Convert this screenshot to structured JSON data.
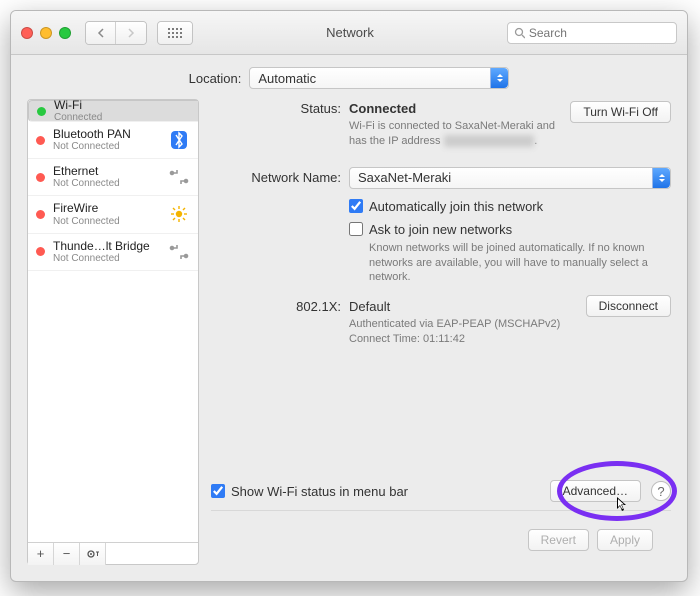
{
  "window": {
    "title": "Network"
  },
  "search": {
    "placeholder": "Search"
  },
  "location": {
    "label": "Location:",
    "value": "Automatic"
  },
  "sidebar": {
    "items": [
      {
        "name": "Wi-Fi",
        "sub": "Connected",
        "status_color": "#28c940",
        "icon": "wifi",
        "selected": true
      },
      {
        "name": "Bluetooth PAN",
        "sub": "Not Connected",
        "status_color": "#ff5a52",
        "icon": "bluetooth",
        "selected": false
      },
      {
        "name": "Ethernet",
        "sub": "Not Connected",
        "status_color": "#ff5a52",
        "icon": "ethernet",
        "selected": false
      },
      {
        "name": "FireWire",
        "sub": "Not Connected",
        "status_color": "#ff5a52",
        "icon": "firewire",
        "selected": false
      },
      {
        "name": "Thunde…lt Bridge",
        "sub": "Not Connected",
        "status_color": "#ff5a52",
        "icon": "thunderbolt",
        "selected": false
      }
    ]
  },
  "status": {
    "label": "Status:",
    "value": "Connected",
    "toggle_label": "Turn Wi-Fi Off",
    "detail_prefix": "Wi-Fi is connected to SaxaNet-Meraki and has the IP address",
    "detail_ip": "redacted",
    "detail_suffix": "."
  },
  "network": {
    "label": "Network Name:",
    "value": "SaxaNet-Meraki",
    "auto_join": {
      "checked": true,
      "label": "Automatically join this network"
    },
    "ask_join": {
      "checked": false,
      "label": "Ask to join new networks"
    },
    "ask_help": "Known networks will be joined automatically. If no known networks are available, you will have to manually select a network."
  },
  "eap": {
    "label": "802.1X:",
    "value": "Default",
    "disconnect_label": "Disconnect",
    "auth_line": "Authenticated via EAP-PEAP (MSCHAPv2)",
    "time_line": "Connect Time: 01:11:42"
  },
  "menubar": {
    "checked": true,
    "label": "Show Wi-Fi status in menu bar"
  },
  "advanced_label": "Advanced…",
  "buttons": {
    "revert": "Revert",
    "apply": "Apply"
  }
}
